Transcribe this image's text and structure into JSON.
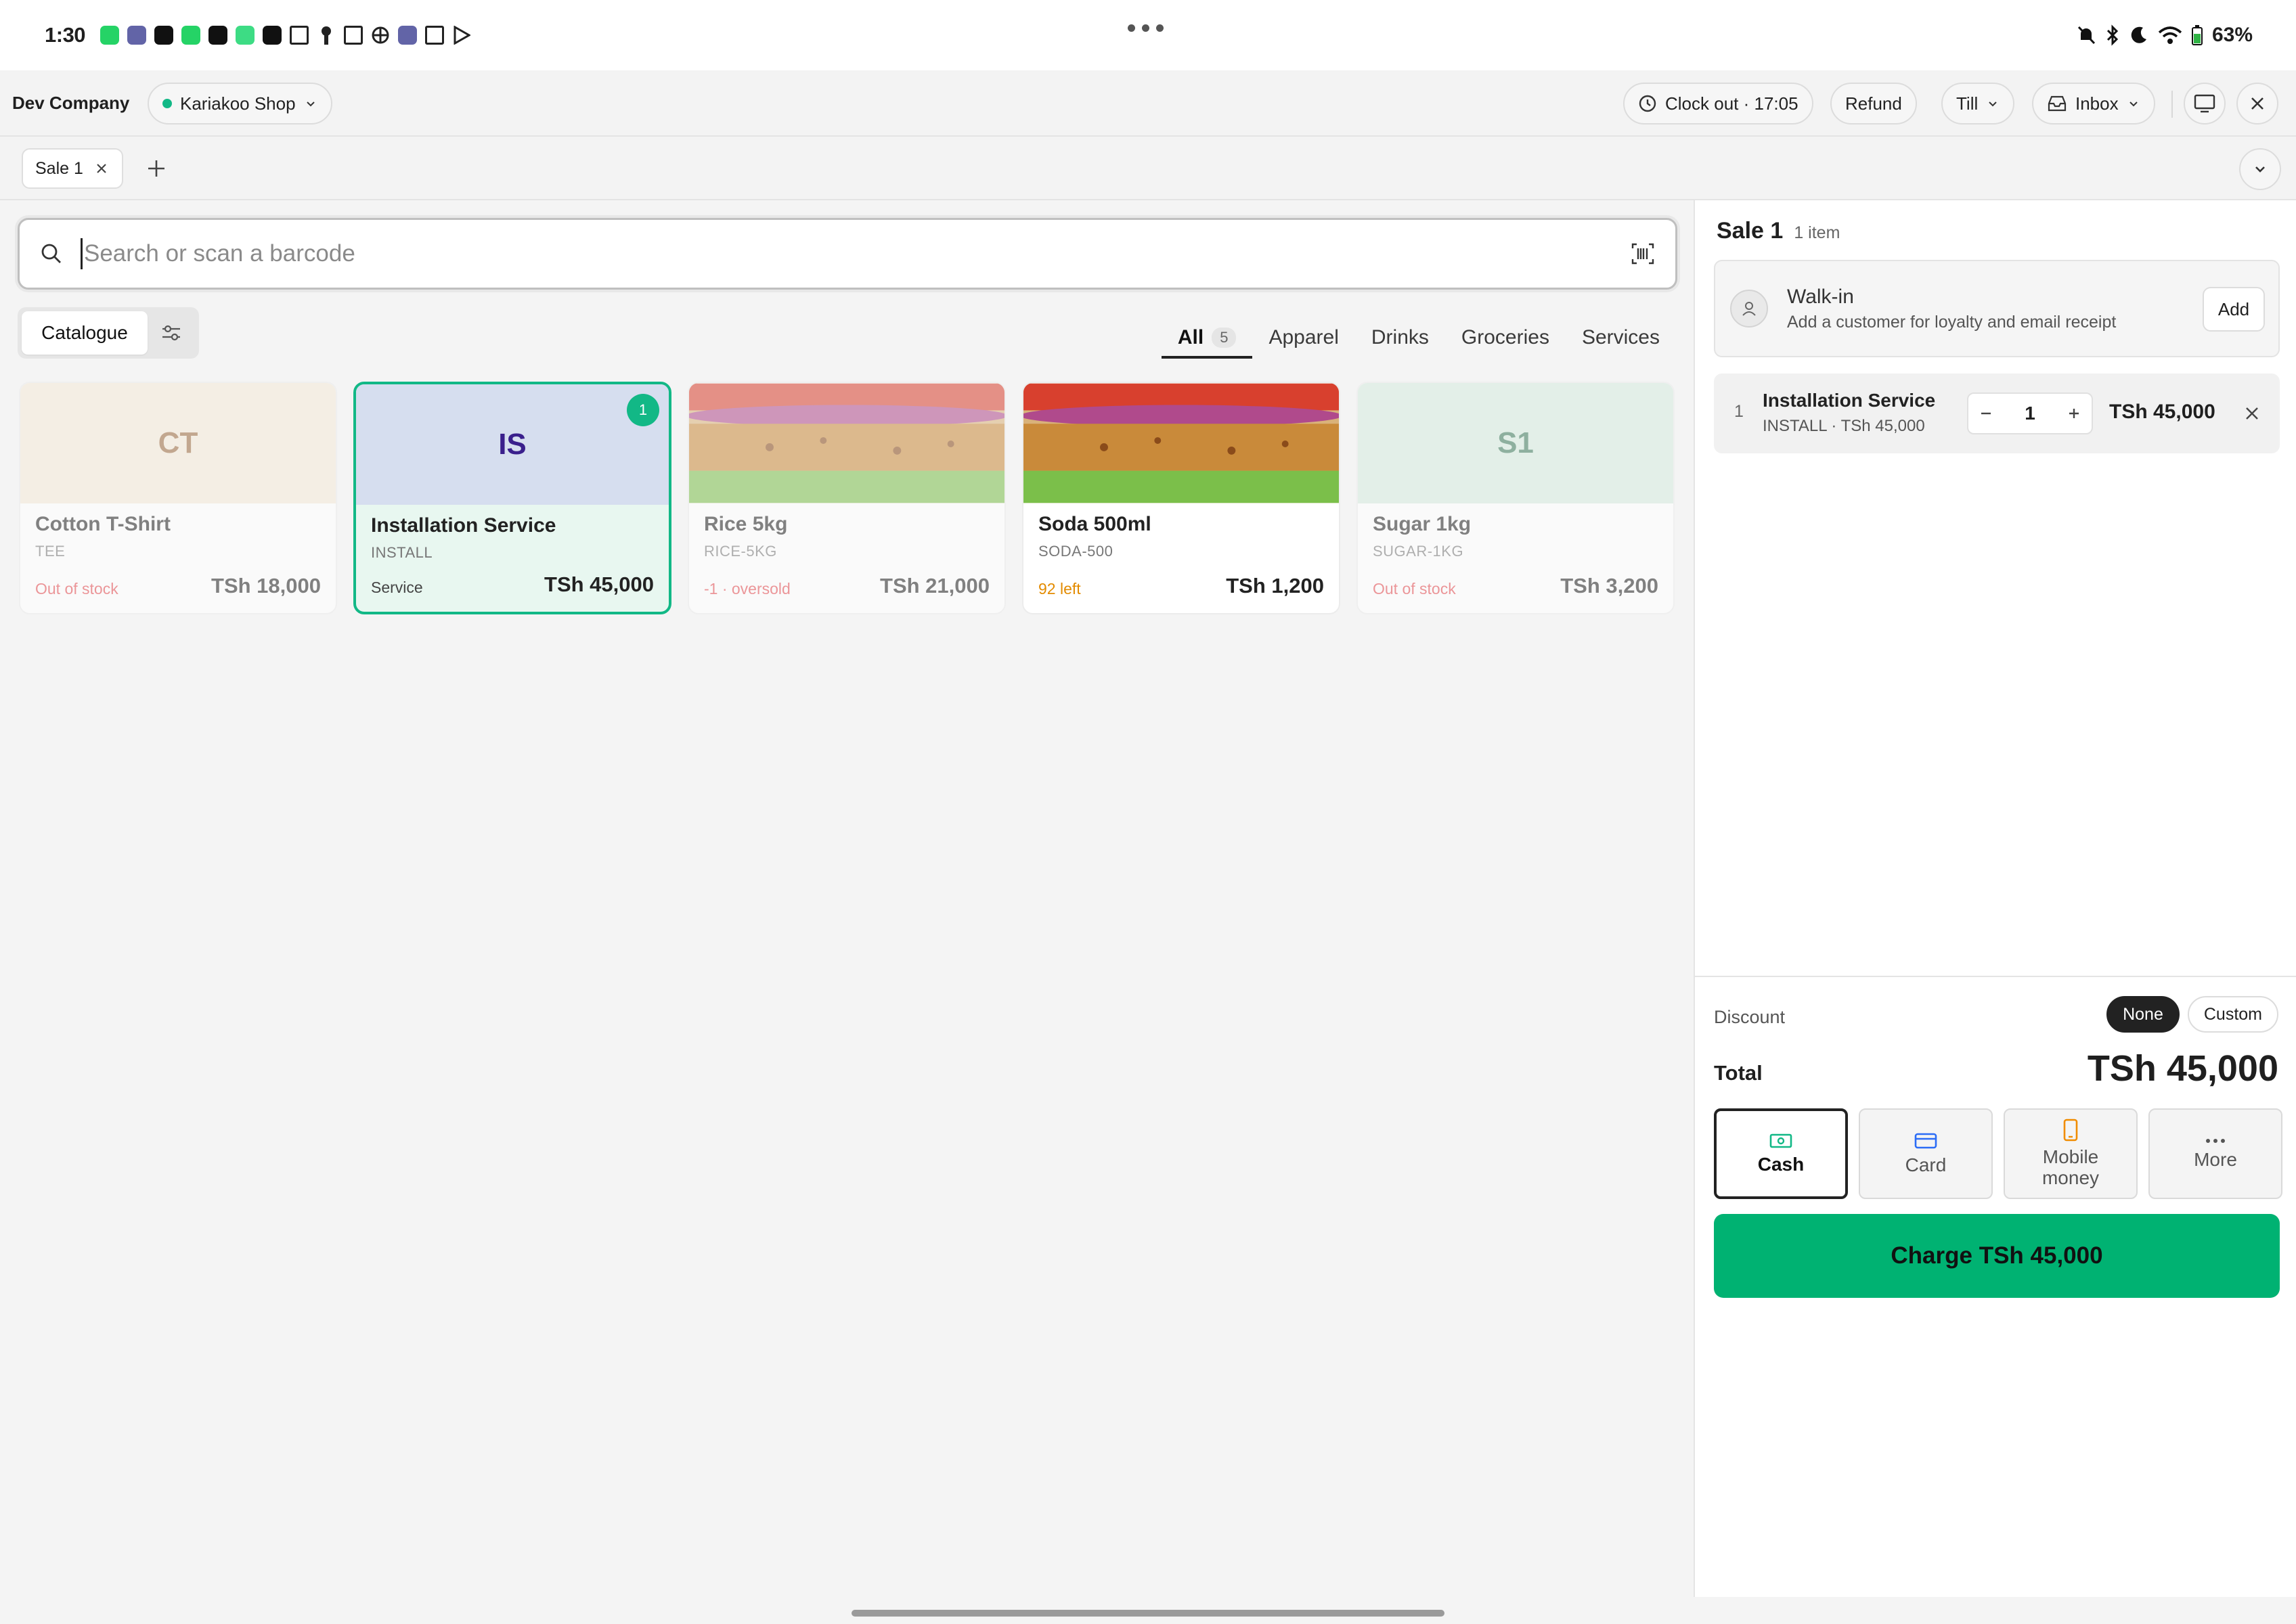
{
  "status_bar": {
    "time": "1:30",
    "battery": "63%",
    "icons": [
      "whatsapp-icon",
      "teams-icon",
      "youtube-icon",
      "whatsapp-icon",
      "youtube-icon",
      "android-icon",
      "youtube-icon",
      "gmail-icon",
      "keyhole-icon",
      "gmail-icon",
      "pinwheel-icon",
      "teams-icon",
      "calendar-icon",
      "play-store-icon"
    ],
    "right_icons": [
      "mute-icon",
      "bluetooth-icon",
      "moon-icon",
      "wifi-icon",
      "battery-icon"
    ]
  },
  "appbar": {
    "company": "Dev Company",
    "shop": "Kariakoo Shop",
    "clock_out": "Clock out · 17:05",
    "refund": "Refund",
    "till": "Till",
    "inbox": "Inbox"
  },
  "tabs": {
    "sale_tab": "Sale 1"
  },
  "search": {
    "placeholder": "Search or scan a barcode"
  },
  "catalogue": {
    "toggle_label": "Catalogue",
    "categories": [
      {
        "label": "All",
        "count": "5"
      },
      {
        "label": "Apparel"
      },
      {
        "label": "Drinks"
      },
      {
        "label": "Groceries"
      },
      {
        "label": "Services"
      }
    ]
  },
  "products": [
    {
      "initials": "CT",
      "name": "Cotton T-Shirt",
      "sku": "TEE",
      "stock": "Out of stock",
      "price": "TSh 18,000"
    },
    {
      "initials": "IS",
      "name": "Installation Service",
      "sku": "INSTALL",
      "stock": "Service",
      "price": "TSh 45,000",
      "qty": "1"
    },
    {
      "name": "Rice 5kg",
      "sku": "RICE-5KG",
      "stock": "-1 · oversold",
      "price": "TSh 21,000"
    },
    {
      "name": "Soda 500ml",
      "sku": "SODA-500",
      "stock": "92 left",
      "price": "TSh 1,200"
    },
    {
      "initials": "S1",
      "name": "Sugar 1kg",
      "sku": "SUGAR-1KG",
      "stock": "Out of stock",
      "price": "TSh 3,200"
    }
  ],
  "cart": {
    "title": "Sale 1",
    "count": "1 item",
    "customer": {
      "name": "Walk-in",
      "subtitle": "Add a customer for loyalty and email receipt",
      "add_label": "Add"
    },
    "items": [
      {
        "index": "1",
        "name": "Installation Service",
        "sub": "INSTALL · TSh 45,000",
        "qty": "1",
        "price": "TSh 45,000"
      }
    ],
    "discount_label": "Discount",
    "discount_options": [
      "None",
      "Custom"
    ],
    "total_label": "Total",
    "total": "TSh 45,000",
    "payment_methods": [
      "Cash",
      "Card",
      "Mobile money",
      "More"
    ],
    "charge_label": "Charge TSh 45,000"
  },
  "colors": {
    "accent": "#12b886",
    "charge": "#00b272",
    "danger": "#e5484d",
    "warning": "#e38b00"
  }
}
